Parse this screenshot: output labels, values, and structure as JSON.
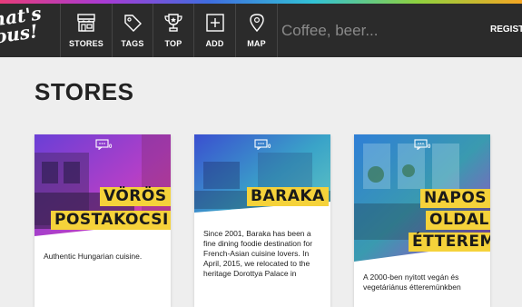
{
  "brand": {
    "logo_text": "That's\nnous!",
    "accent": "#f5d23a",
    "navbar_bg": "#2b2b2b"
  },
  "nav": {
    "items": [
      {
        "label": "STORES",
        "icon": "storefront-icon"
      },
      {
        "label": "TAGS",
        "icon": "tag-icon"
      },
      {
        "label": "TOP",
        "icon": "trophy-icon"
      },
      {
        "label": "ADD",
        "icon": "plus-box-icon"
      },
      {
        "label": "MAP",
        "icon": "map-pin-icon"
      }
    ],
    "search_placeholder": "Coffee, beer...",
    "register_label": "REGISTER"
  },
  "page": {
    "title": "STORES"
  },
  "stores": [
    {
      "name_lines": [
        "VÖRÖS",
        "POSTAKOCSI"
      ],
      "description": "Authentic Hungarian cuisine.",
      "comment_count": "0"
    },
    {
      "name_lines": [
        "BARAKA"
      ],
      "description": "Since 2001, Baraka has been a fine dining foodie destination for French-Asian cuisine lovers. In April, 2015, we relocated to the heritage Dorottya Palace in",
      "comment_count": "0"
    },
    {
      "name_lines": [
        "NAPOS",
        "OLDAL",
        "ÉTTEREM"
      ],
      "description": "A 2000-ben nyitott vegán és vegetáriánus étteremünkben",
      "comment_count": "0"
    }
  ]
}
